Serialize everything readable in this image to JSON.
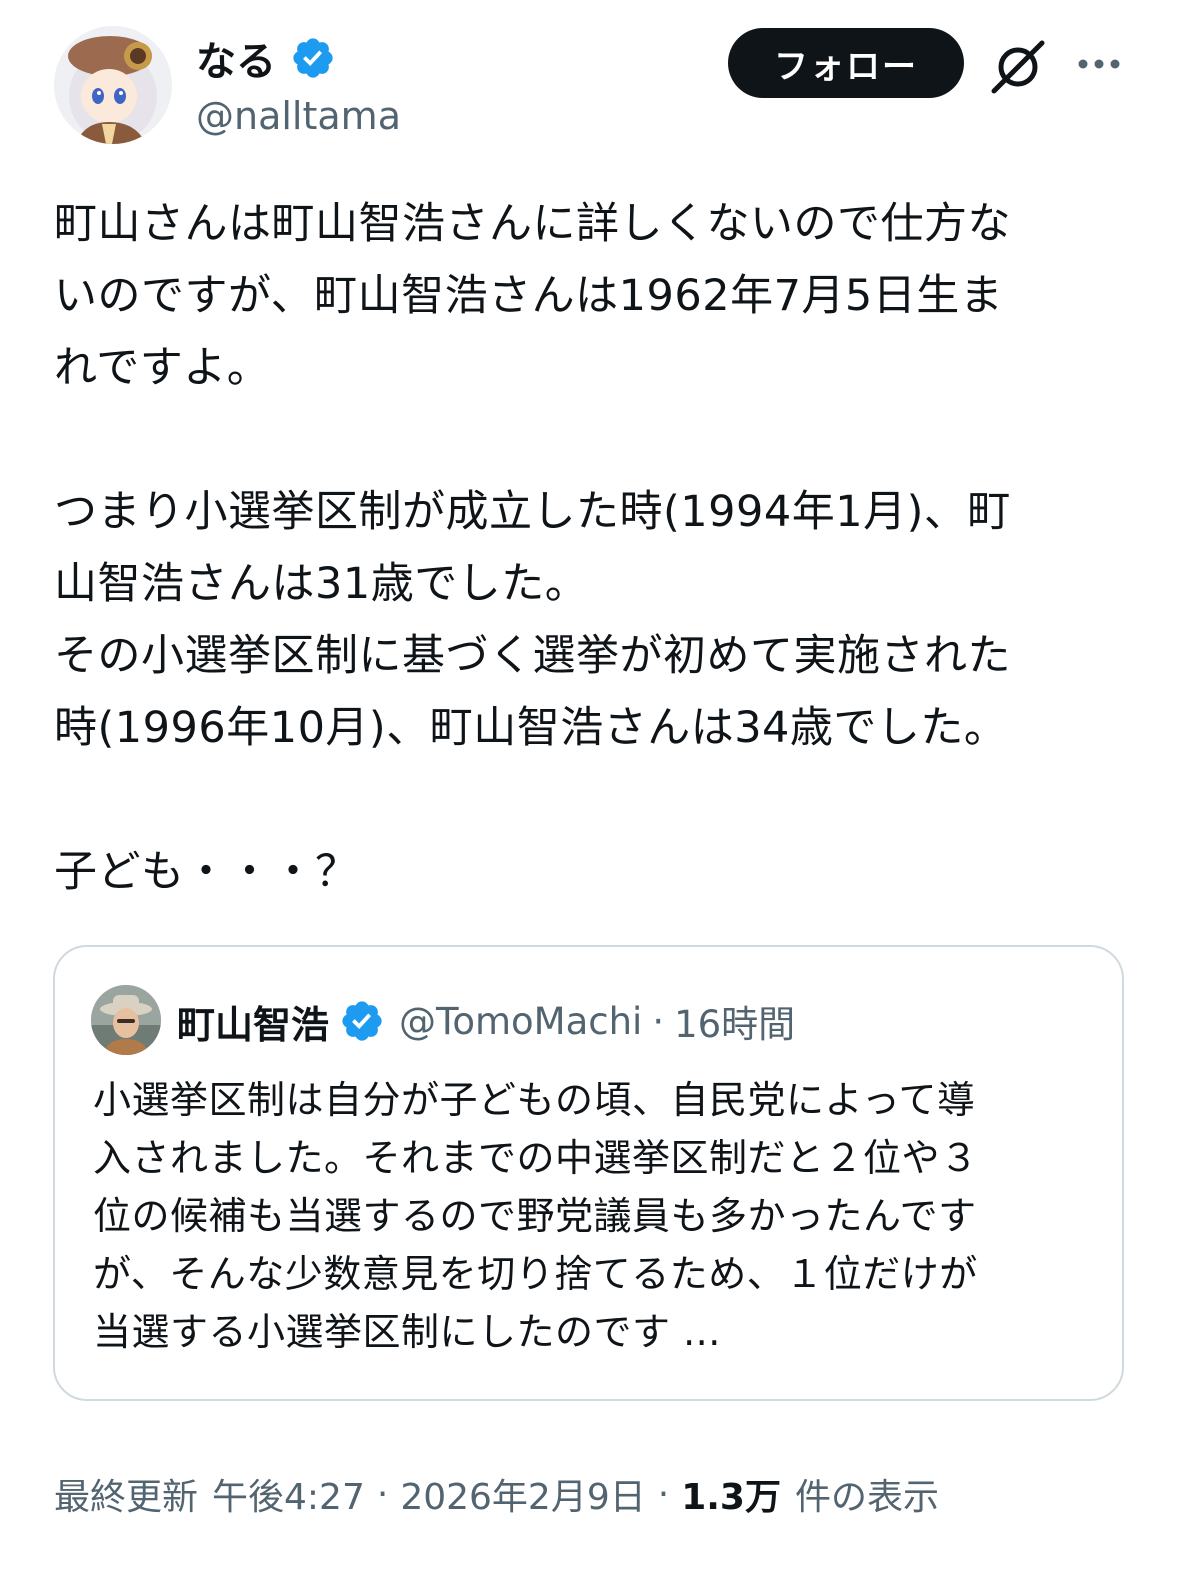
{
  "author": {
    "display_name": "なる",
    "handle": "@nalltama",
    "verified": true
  },
  "follow_label": "フォロー",
  "icons": {
    "verified": "verified-badge-icon",
    "grok": "grok-icon",
    "more": "more-options-icon"
  },
  "colors": {
    "verified_blue": "#1d9bf0",
    "button_bg": "#0f1419",
    "secondary_text": "#536471",
    "border": "#cfd9de"
  },
  "tweet": {
    "paragraph1": "町山さんは町山智浩さんに詳しくないので仕方な\nいのですが、町山智浩さんは1962年7月5日生ま\nれですよ。",
    "paragraph2": "つまり小選挙区制が成立した時(1994年1月)、町\n山智浩さんは31歳でした。\nその小選挙区制に基づく選挙が初めて実施された\n時(1996年10月)、町山智浩さんは34歳でした。",
    "paragraph3": "子ども・・・？"
  },
  "quote": {
    "display_name": "町山智浩",
    "handle": "@TomoMachi",
    "separator": "·",
    "time": "16時間",
    "text": "小選挙区制は自分が子どもの頃、自民党によって導\n入されました。それまでの中選挙区制だと２位や３\n位の候補も当選するので野党議員も多かったんです\nが、そんな少数意見を切り捨てるため、１位だけが\n当選する小選挙区制にしたのです ..."
  },
  "meta": {
    "updated_label": "最終更新",
    "time": "午後4:27",
    "separator": "·",
    "date": "2026年2月9日",
    "views_count": "1.3万",
    "views_label": "件の表示"
  }
}
